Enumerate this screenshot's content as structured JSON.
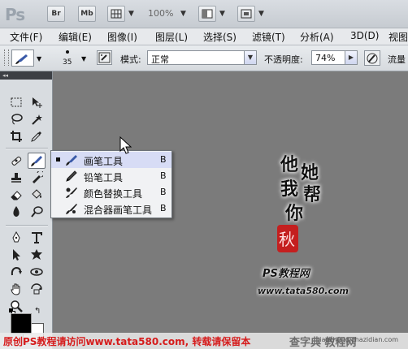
{
  "app": {
    "logo": "Ps",
    "bridge_label": "Br",
    "minibridge_label": "Mb",
    "zoom": "100%"
  },
  "menu": [
    "文件(F)",
    "编辑(E)",
    "图像(I)",
    "图层(L)",
    "选择(S)",
    "滤镜(T)",
    "分析(A)",
    "3D(D)",
    "视图"
  ],
  "options": {
    "brush_size": "35",
    "mode_label": "模式:",
    "mode_value": "正常",
    "opacity_label": "不透明度:",
    "opacity_value": "74%",
    "flow_label": "流量"
  },
  "tools_panel": {
    "collapse_glyph": "◂◂"
  },
  "flyout": [
    {
      "label": "画笔工具",
      "key": "B",
      "icon": "brush-icon"
    },
    {
      "label": "铅笔工具",
      "key": "B",
      "icon": "pencil-icon"
    },
    {
      "label": "颜色替换工具",
      "key": "B",
      "icon": "color-replacement-icon"
    },
    {
      "label": "混合器画笔工具",
      "key": "B",
      "icon": "mixer-brush-icon"
    }
  ],
  "canvas_art": {
    "calligraphy": [
      "他",
      "她",
      "我",
      "帮",
      "你"
    ],
    "seal_text": "秋",
    "site_name": "PS教程网",
    "site_url": "www.tata580.com"
  },
  "watermark": {
    "text": "原创PS教程请访问www.tata580.com, 转载请保留本",
    "site": "查字典 教程网",
    "url": "jiaocheng.chazidian.com"
  },
  "colors": {
    "foreground": "#000000",
    "background": "#ffffff",
    "canvas": "#7b7b7b",
    "selection": "#d7dcf5",
    "watermark_red": "#d61c1c"
  }
}
